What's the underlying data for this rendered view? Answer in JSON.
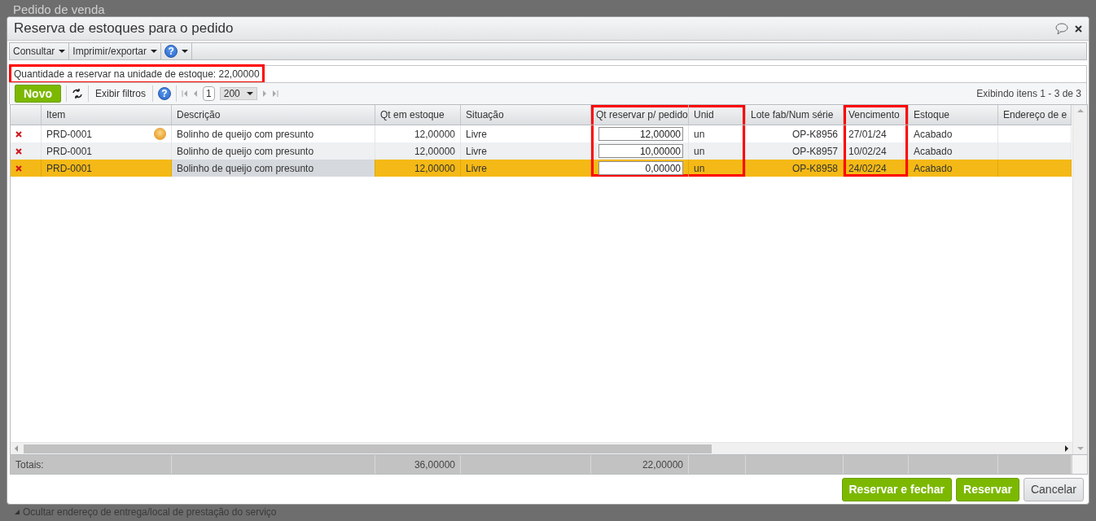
{
  "background_window": {
    "title": "Pedido de venda",
    "footer_link": "Ocultar endereço de entrega/local de prestação do serviço"
  },
  "dialog": {
    "title": "Reserva de estoques para o pedido"
  },
  "menu": [
    {
      "kind": "dropdown",
      "label": "Consultar"
    },
    {
      "kind": "dropdown",
      "label": "Imprimir/exportar"
    },
    {
      "kind": "help",
      "label": "?"
    }
  ],
  "info": {
    "text": "Quantidade a reservar na unidade de estoque: 22,00000",
    "highlighted": true
  },
  "toolbar": {
    "new_button": "Novo",
    "filters_button": "Exibir filtros",
    "help_icon": "?",
    "page": "1",
    "page_size": "200",
    "status": "Exibindo itens 1 - 3 de 3"
  },
  "table": {
    "columns": [
      {
        "label": "Item",
        "kind": "text",
        "highlighted": false
      },
      {
        "label": "Descrição",
        "kind": "text",
        "highlighted": false
      },
      {
        "label": "Qt em estoque",
        "kind": "number",
        "highlighted": false
      },
      {
        "label": "Situação",
        "kind": "text",
        "highlighted": false
      },
      {
        "label": "Qt reservar p/ pedido",
        "kind": "input",
        "highlighted": true
      },
      {
        "label": "Unid",
        "kind": "text",
        "highlighted": true
      },
      {
        "label": "Lote fab/Num série",
        "kind": "number",
        "highlighted": false
      },
      {
        "label": "Vencimento",
        "kind": "text",
        "highlighted": true
      },
      {
        "label": "Estoque",
        "kind": "text",
        "highlighted": false
      },
      {
        "label": "Endereço de e",
        "kind": "text",
        "highlighted": false
      }
    ],
    "rows": [
      {
        "selected": false,
        "indicator": true,
        "cells": [
          "PRD-0001",
          "Bolinho de queijo com presunto",
          "12,00000",
          "Livre",
          "12,00000",
          "un",
          "OP-K8956",
          "27/01/24",
          "Acabado"
        ]
      },
      {
        "selected": false,
        "indicator": false,
        "cells": [
          "PRD-0001",
          "Bolinho de queijo com presunto",
          "12,00000",
          "Livre",
          "10,00000",
          "un",
          "OP-K8957",
          "10/02/24",
          "Acabado"
        ]
      },
      {
        "selected": true,
        "indicator": false,
        "cells": [
          "PRD-0001",
          {
            "text": "Bolinho de queijo com presunto",
            "focused": true
          },
          "12,00000",
          "Livre",
          "0,00000",
          "un",
          "OP-K8958",
          "24/02/24",
          "Acabado"
        ]
      }
    ],
    "totals": {
      "label": "Totais:",
      "cells": [
        null,
        null,
        "36,00000",
        null,
        "22,00000",
        null,
        null,
        null,
        null,
        null
      ]
    }
  },
  "buttons": [
    {
      "label": "Reservar e fechar",
      "kind": "primary"
    },
    {
      "label": "Reservar",
      "kind": "primary"
    },
    {
      "label": "Cancelar",
      "kind": "secondary"
    }
  ]
}
